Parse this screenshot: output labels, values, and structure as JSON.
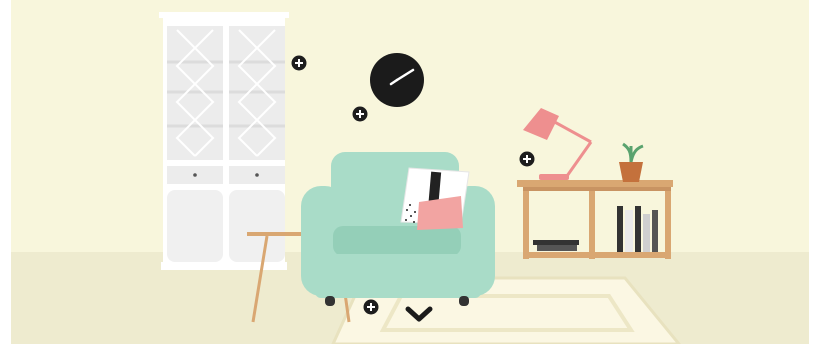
{
  "colors": {
    "wall": "#f8f6dc",
    "floor": "#eeebcf",
    "cabinet": "#ffffff",
    "cabinet_glass": "#ececec",
    "armchair": "#a9dcc8",
    "armchair_shade": "#94cfb8",
    "wood": "#d9a772",
    "clock": "#1b1b1b",
    "lamp": "#ee8f8f",
    "pillow_pink": "#f2a4a2",
    "plant": "#5aa36e",
    "rug": "#fbf7e3",
    "rug_border": "#e8e2bf",
    "hotspot": "#1d1d1d"
  },
  "scene": {
    "name": "living-room-illustration",
    "hotspots": [
      {
        "id": "cabinet",
        "icon": "plus-icon"
      },
      {
        "id": "clock",
        "icon": "plus-icon"
      },
      {
        "id": "lamp",
        "icon": "plus-icon"
      },
      {
        "id": "armchair",
        "icon": "plus-icon"
      }
    ],
    "scroll_icon": "chevron-down-icon"
  }
}
